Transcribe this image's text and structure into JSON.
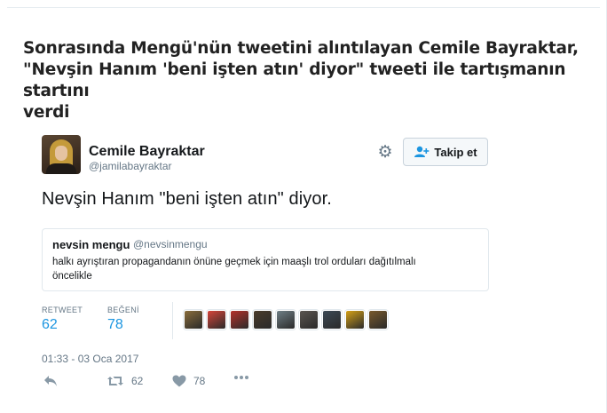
{
  "headline": {
    "line1": "Sonrasında Mengü'nün tweetini alıntılayan Cemile Bayraktar,",
    "line2": "\"Nevşin Hanım 'beni işten atın' diyor\" tweeti ile tartışmanın startını",
    "line3": "verdi"
  },
  "tweet": {
    "author_name": "Cemile Bayraktar",
    "author_handle": "@jamilabayraktar",
    "follow_label": "Takip et",
    "text": "Nevşin Hanım \"beni işten atın\" diyor.",
    "quote": {
      "name": "nevsin mengu",
      "handle": "@nevsinmengu",
      "line1": "halkı ayrıştıran propagandanın önüne geçmek için maaşlı trol orduları dağıtılmalı",
      "line2": "öncelikle"
    },
    "stats": {
      "retweet_label": "RETWEET",
      "retweet_count": "62",
      "like_label": "BEĞENİ",
      "like_count": "78"
    },
    "likers": [
      {
        "icon": "liker-avatar",
        "color": "#8a6d3b"
      },
      {
        "icon": "liker-avatar",
        "color": "#d6443a"
      },
      {
        "icon": "liker-avatar",
        "color": "#b5302a"
      },
      {
        "icon": "liker-avatar",
        "color": "#4a3b2a"
      },
      {
        "icon": "liker-avatar",
        "color": "#6f7f86"
      },
      {
        "icon": "liker-avatar",
        "color": "#5b5550"
      },
      {
        "icon": "liker-avatar",
        "color": "#3d4a55"
      },
      {
        "icon": "liker-avatar",
        "color": "#d4a017"
      },
      {
        "icon": "liker-avatar",
        "color": "#7a5a2c"
      }
    ],
    "timestamp": "01:33 - 03 Oca 2017",
    "actions": {
      "reply_icon": "reply-icon",
      "retweet_icon": "retweet-icon",
      "retweet_count": "62",
      "like_icon": "heart-icon",
      "like_count": "78",
      "more_icon": "more-icon"
    }
  },
  "colors": {
    "link": "#1b95e0",
    "muted": "#657786",
    "text": "#14171a",
    "border": "#e1e8ed"
  }
}
